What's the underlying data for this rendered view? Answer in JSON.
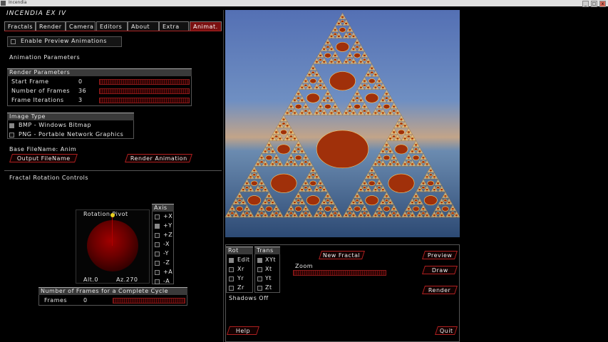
{
  "window": {
    "title": "Incendia",
    "min": "_",
    "max": "□",
    "close": "x"
  },
  "app_title": "INCENDIA EX IV",
  "tabs": [
    {
      "label": "Fractals"
    },
    {
      "label": "Render"
    },
    {
      "label": "Camera"
    },
    {
      "label": "Editors"
    },
    {
      "label": "About"
    },
    {
      "label": "Extra"
    },
    {
      "label": "Animat."
    }
  ],
  "preview": {
    "label": "Enable Preview Animations",
    "checked": false
  },
  "anim_params_title": "Animation Parameters",
  "render_params": {
    "title": "Render Parameters",
    "rows": [
      {
        "label": "Start Frame",
        "value": "0"
      },
      {
        "label": "Number of Frames",
        "value": "36"
      },
      {
        "label": "Frame Iterations",
        "value": "3"
      }
    ]
  },
  "image_type": {
    "title": "Image Type",
    "options": [
      {
        "label": "BMP - Windows Bitmap",
        "checked": true
      },
      {
        "label": "PNG - Portable Network Graphics",
        "checked": false
      }
    ]
  },
  "base_filename": "Base FileName: Anim",
  "buttons": {
    "output_filename": "Output FileName",
    "render_animation": "Render Animation"
  },
  "rotation": {
    "title": "Fractal Rotation Controls",
    "pivot_label": "Rotation Pivot",
    "alt": "Alt.0",
    "az": "Az.270",
    "axis_title": "Axis",
    "axes": [
      {
        "label": "+X",
        "checked": false
      },
      {
        "label": "+Y",
        "checked": true
      },
      {
        "label": "+Z",
        "checked": false
      },
      {
        "label": "-X",
        "checked": false
      },
      {
        "label": "-Y",
        "checked": false
      },
      {
        "label": "-Z",
        "checked": false
      },
      {
        "label": "+A",
        "checked": false
      },
      {
        "label": "-A",
        "checked": false
      }
    ]
  },
  "cycle": {
    "title": "Number of Frames for a Complete Cycle",
    "label": "Frames",
    "value": "0"
  },
  "controls": {
    "rot_title": "Rot",
    "trans_title": "Trans",
    "rot": [
      {
        "label": "Edit",
        "checked": true
      },
      {
        "label": "Xr",
        "checked": false
      },
      {
        "label": "Yr",
        "checked": false
      },
      {
        "label": "Zr",
        "checked": false
      }
    ],
    "trans": [
      {
        "label": "XYt",
        "checked": true
      },
      {
        "label": "Xt",
        "checked": false
      },
      {
        "label": "Yt",
        "checked": false
      },
      {
        "label": "Zt",
        "checked": false
      }
    ],
    "new_fractal": "New Fractal",
    "zoom": "Zoom",
    "shadows": "Shadows Off",
    "preview": "Preview",
    "draw": "Draw",
    "render": "Render",
    "help": "Help",
    "quit": "Quit"
  },
  "colors": {
    "accent": "#b02020",
    "active_tab": "#7a1010",
    "sky_top": "#5470b4",
    "horizon": "#c2a489",
    "fractal": "#ffd27a"
  }
}
